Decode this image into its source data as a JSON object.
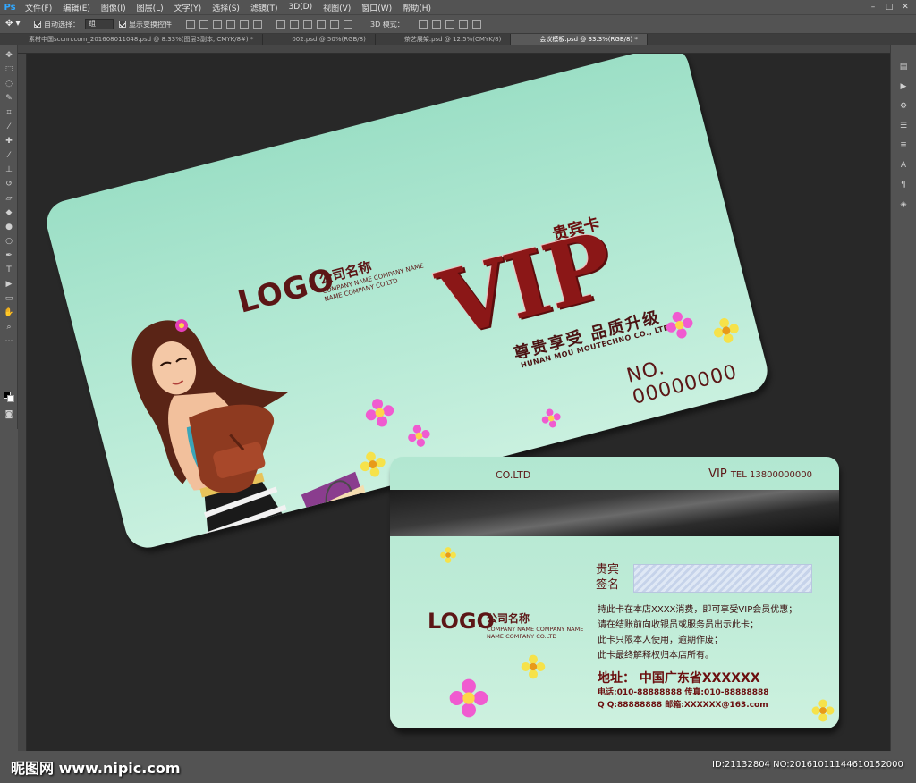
{
  "app": {
    "logo": "Ps",
    "menus": [
      "文件(F)",
      "编辑(E)",
      "图像(I)",
      "图层(L)",
      "文字(Y)",
      "选择(S)",
      "滤镜(T)",
      "3D(D)",
      "视图(V)",
      "窗口(W)",
      "帮助(H)"
    ]
  },
  "options": {
    "auto_select_label": "自动选择：",
    "auto_select_value": "组",
    "show_transform_label": "显示变换控件",
    "mode_3d_label": "3D 模式："
  },
  "tabs": [
    {
      "label": "素材中国sccnn.com_201608011048.psd @ 8.33%(图层3副本, CMYK/8#) *",
      "active": false
    },
    {
      "label": "002.psd @ 50%(RGB/8)",
      "active": false
    },
    {
      "label": "茶艺展架.psd @ 12.5%(CMYK/8)",
      "active": false
    },
    {
      "label": "会议模板.psd @ 33.3%(RGB/8) *",
      "active": true
    }
  ],
  "front_card": {
    "logo": "LOGO",
    "company_cn": "公司名称",
    "company_en_1": "COMPANY NAME COMPANY NAME",
    "company_en_2": "NAME COMPANY CO.LTD",
    "vip": "VIP",
    "vip_cn": "贵宾卡",
    "slogan": "尊贵享受  品质升级",
    "company_full_en": "HUNAN MOU MOUTECHNO CO., LTD.",
    "no_label": "NO.",
    "no_value": "00000000"
  },
  "back_card": {
    "top_vip": "VIP",
    "top_tel": "TEL 13800000000",
    "left_cut": "CO.LTD",
    "sig_label_1": "贵宾",
    "sig_label_2": "签名",
    "logo": "LOGO",
    "company_cn": "公司名称",
    "company_en_1": "COMPANY NAME COMPANY NAME",
    "company_en_2": "NAME COMPANY CO.LTD",
    "rule_1": "持此卡在本店XXXX消费，即可享受VIP会员优惠；",
    "rule_2": "请在结账前向收银员或服务员出示此卡；",
    "rule_3": "此卡只限本人使用，逾期作废；",
    "rule_4": "此卡最终解释权归本店所有。",
    "address": "地址：  中国广东省XXXXXX",
    "phone": "电话:010-88888888   传真:010-88888888",
    "qq_email": "Q Q:88888888   邮箱:XXXXXX@163.com"
  },
  "watermark": {
    "left": "昵图网 www.nipic.com",
    "right": "ID:21132804 NO:20161011144610152000"
  },
  "colors": {
    "ps_background": "#535353",
    "card_mint": "#a8e3cb",
    "brand_red": "#8b1717"
  }
}
